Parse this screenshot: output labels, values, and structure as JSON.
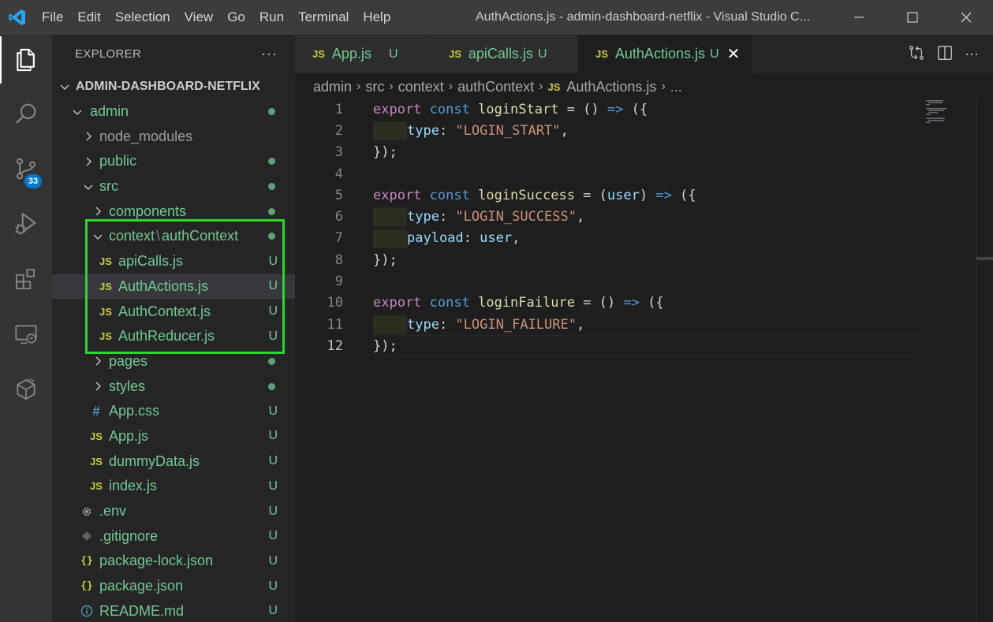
{
  "titlebar": {
    "menu": [
      "File",
      "Edit",
      "Selection",
      "View",
      "Go",
      "Run",
      "Terminal",
      "Help"
    ],
    "title": "AuthActions.js - admin-dashboard-netflix - Visual Studio C..."
  },
  "activitybar": {
    "icons": [
      "explorer-icon",
      "search-icon",
      "source-control-icon",
      "run-debug-icon",
      "extensions-icon",
      "remote-explorer-icon",
      "docker-icon"
    ],
    "source_control_badge": "33"
  },
  "sidebar": {
    "title": "EXPLORER",
    "more": "···",
    "root": "ADMIN-DASHBOARD-NETFLIX",
    "items": [
      {
        "label": "admin",
        "status": "dot"
      },
      {
        "label": "node_modules",
        "status": ""
      },
      {
        "label": "public",
        "status": "dot"
      },
      {
        "label": "src",
        "status": "dot"
      },
      {
        "label": "components",
        "status": "dot"
      },
      {
        "label": "context",
        "label2": "authContext",
        "status": "dot"
      },
      {
        "label": "apiCalls.js",
        "status": "U"
      },
      {
        "label": "AuthActions.js",
        "status": "U"
      },
      {
        "label": "AuthContext.js",
        "status": "U"
      },
      {
        "label": "AuthReducer.js",
        "status": "U"
      },
      {
        "label": "pages",
        "status": "dot"
      },
      {
        "label": "styles",
        "status": "dot"
      },
      {
        "label": "App.css",
        "status": "U"
      },
      {
        "label": "App.js",
        "status": "U"
      },
      {
        "label": "dummyData.js",
        "status": "U"
      },
      {
        "label": "index.js",
        "status": "U"
      },
      {
        "label": ".env",
        "status": "U"
      },
      {
        "label": ".gitignore",
        "status": "U"
      },
      {
        "label": "package-lock.json",
        "status": "U"
      },
      {
        "label": "package.json",
        "status": "U"
      },
      {
        "label": "README.md",
        "status": "U"
      }
    ],
    "icon_labels": {
      "js": "JS",
      "css": "#",
      "json": "{}"
    }
  },
  "tabs": [
    {
      "label": "App.js",
      "status": "U"
    },
    {
      "label": "apiCalls.js",
      "status": "U"
    },
    {
      "label": "AuthActions.js",
      "status": "U",
      "close": "✕"
    }
  ],
  "breadcrumb": [
    "admin",
    "src",
    "context",
    "authContext",
    "AuthActions.js",
    "..."
  ],
  "code": {
    "line_numbers": [
      "1",
      "2",
      "3",
      "4",
      "5",
      "6",
      "7",
      "8",
      "9",
      "10",
      "11",
      "12"
    ],
    "tokens": {
      "export": "export",
      "const": "const",
      "loginStart": "loginStart",
      "loginSuccess": "loginSuccess",
      "loginFailure": "loginFailure",
      "eq_empty": " = () ",
      "eq_open": " = (",
      "user_param": "user",
      "close_paren": ") ",
      "arrow": "=>",
      "open_obj": " ({",
      "type": "type",
      "payload": "payload",
      "colon": ": ",
      "comma": ",",
      "user_val": "user",
      "str_start": "\"LOGIN_START\"",
      "str_success": "\"LOGIN_SUCCESS\"",
      "str_failure": "\"LOGIN_FAILURE\"",
      "close_obj": "});"
    }
  },
  "colors": {
    "highlight_box": "#2ed62e",
    "git_untracked": "#73c991",
    "accent": "#007acc"
  }
}
